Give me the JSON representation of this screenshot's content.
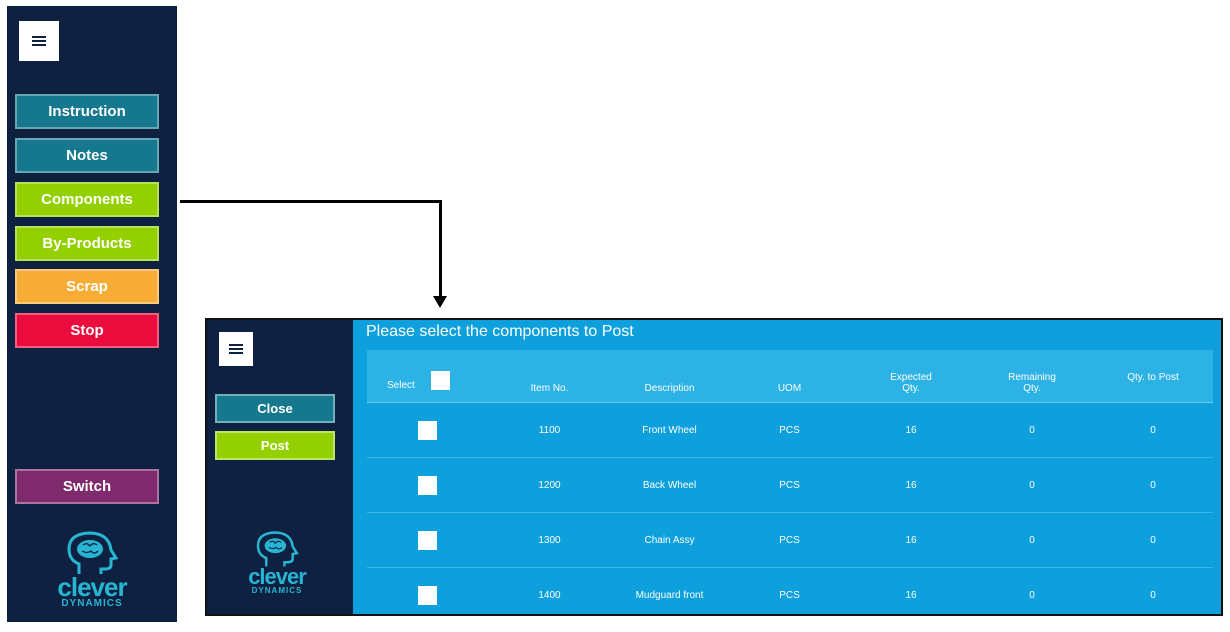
{
  "sidebar": {
    "menu_icon": "hamburger-icon",
    "buttons": {
      "instruction": "Instruction",
      "notes": "Notes",
      "components": "Components",
      "by_products": "By-Products",
      "scrap": "Scrap",
      "stop": "Stop",
      "switch": "Switch"
    },
    "logo": {
      "word": "clever",
      "sub": "DYNAMICS"
    }
  },
  "panel": {
    "title": "Please select the components to Post",
    "side": {
      "close": "Close",
      "post": "Post",
      "logo": {
        "word": "clever",
        "sub": "DYNAMICS"
      }
    },
    "table": {
      "headers": {
        "select": "Select",
        "item_no": "Item No.",
        "description": "Description",
        "uom": "UOM",
        "expected_qty": "Expected Qty.",
        "remaining_qty": "Remaining Qty.",
        "qty_to_post": "Qty. to Post"
      },
      "rows": [
        {
          "item_no": "1100",
          "description": "Front Wheel",
          "uom": "PCS",
          "expected": "16",
          "remaining": "0",
          "to_post": "0"
        },
        {
          "item_no": "1200",
          "description": "Back Wheel",
          "uom": "PCS",
          "expected": "16",
          "remaining": "0",
          "to_post": "0"
        },
        {
          "item_no": "1300",
          "description": "Chain Assy",
          "uom": "PCS",
          "expected": "16",
          "remaining": "0",
          "to_post": "0"
        },
        {
          "item_no": "1400",
          "description": "Mudguard front",
          "uom": "PCS",
          "expected": "16",
          "remaining": "0",
          "to_post": "0"
        }
      ]
    }
  },
  "colors": {
    "navy": "#0f2140",
    "teal": "#16788e",
    "green": "#94d000",
    "orange": "#f6ac35",
    "red": "#eb0b3d",
    "purple": "#7e2a6d",
    "panel_blue": "#0da0dd"
  }
}
